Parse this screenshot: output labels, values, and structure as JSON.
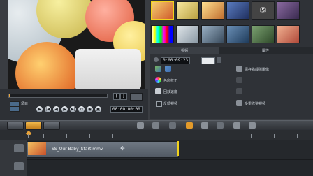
{
  "player": {
    "mode_label": "項目",
    "timecode": "00:00:00:00",
    "mark_in": "[",
    "mark_out": "]"
  },
  "panel": {
    "tabs": [
      "視頻",
      "屬性"
    ],
    "duration": "0:00:09:23",
    "options_left": [
      "色彩校正",
      "回放速度",
      "反轉視頻"
    ],
    "options_right": [
      "保存為靜態圖像",
      "多重修整視頻"
    ]
  },
  "timeline": {
    "clip_name": "SS_Our Baby_Start.mmv"
  },
  "colors": {
    "accent": "#f2d21c",
    "scrub": "#e8a33a"
  }
}
